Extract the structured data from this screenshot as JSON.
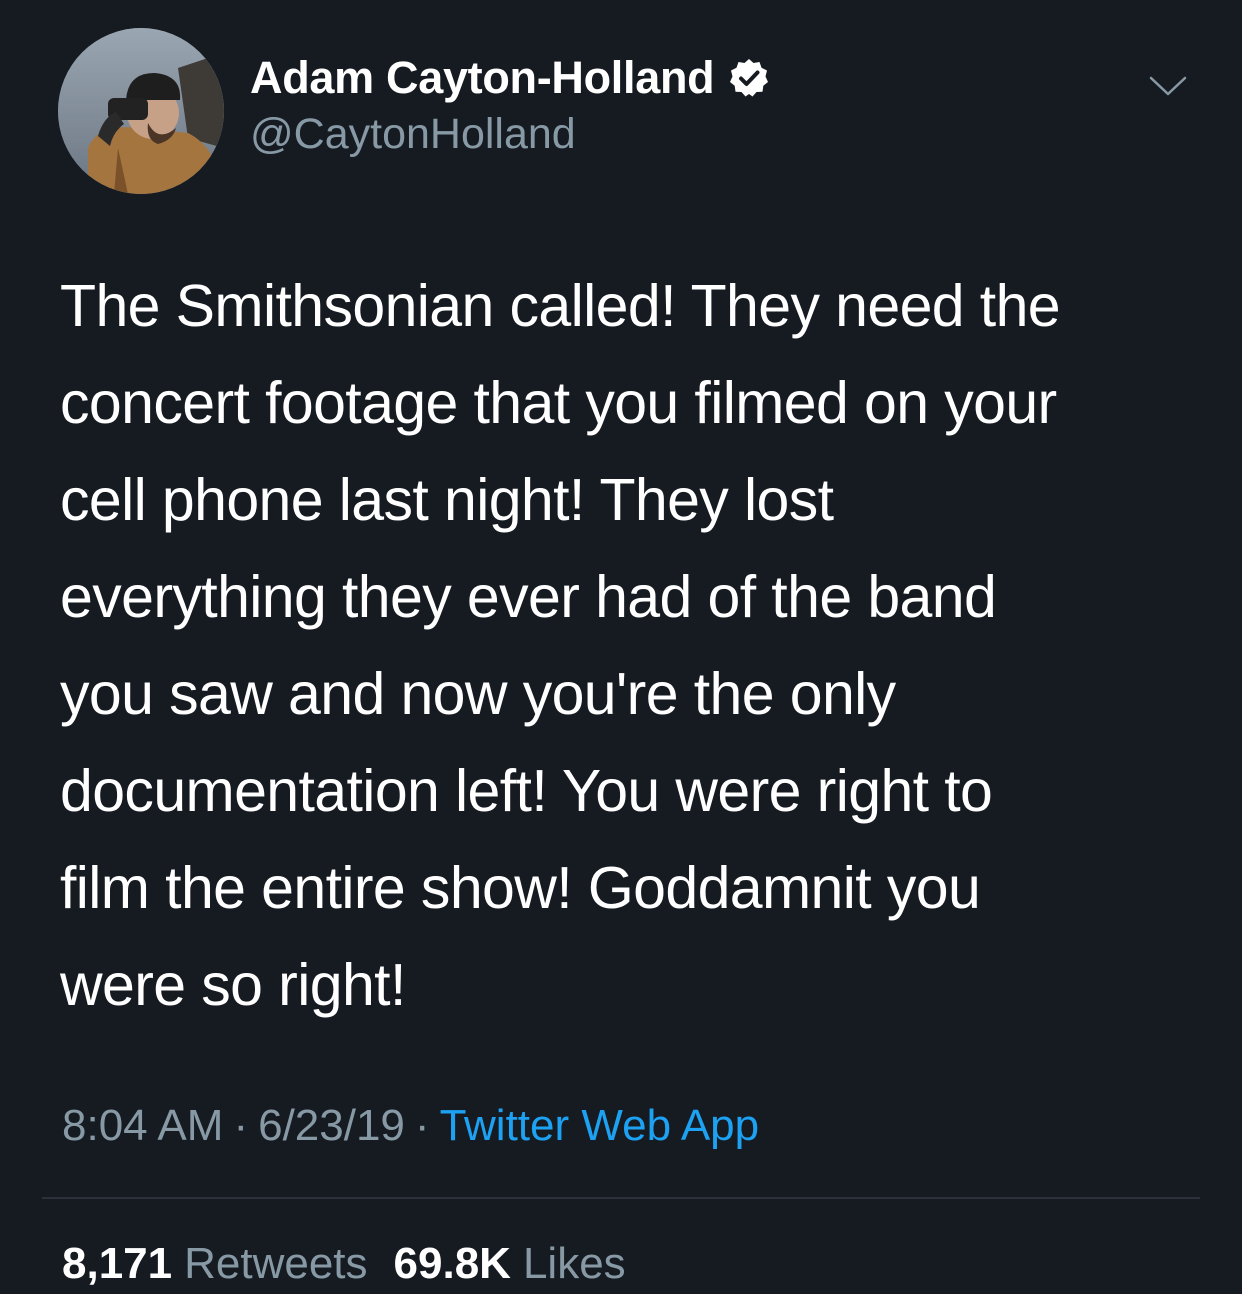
{
  "tweet": {
    "author": {
      "display_name": "Adam Cayton-Holland",
      "handle": "@CaytonHolland",
      "verified": true,
      "avatar_icon": "profile-photo-person-with-binoculars"
    },
    "menu_icon": "chevron-down-icon",
    "text_lines": [
      "The Smithsonian called! They need the",
      "concert footage that you filmed on your",
      "cell phone last night! They lost",
      "everything they ever had of the band",
      "you saw and now you're the only",
      "documentation left! You were right to",
      "film the entire show! Goddamnit you",
      "were so right!"
    ],
    "time": "8:04 AM",
    "date": "6/23/19",
    "separator": "·",
    "source": "Twitter Web App",
    "retweets": {
      "count": "8,171",
      "label": "Retweets"
    },
    "likes": {
      "count": "69.8K",
      "label": "Likes"
    }
  },
  "colors": {
    "background": "#161b22",
    "text_primary": "#ffffff",
    "text_secondary": "#8899a6",
    "link": "#1da1f2",
    "divider": "#2a313b"
  }
}
